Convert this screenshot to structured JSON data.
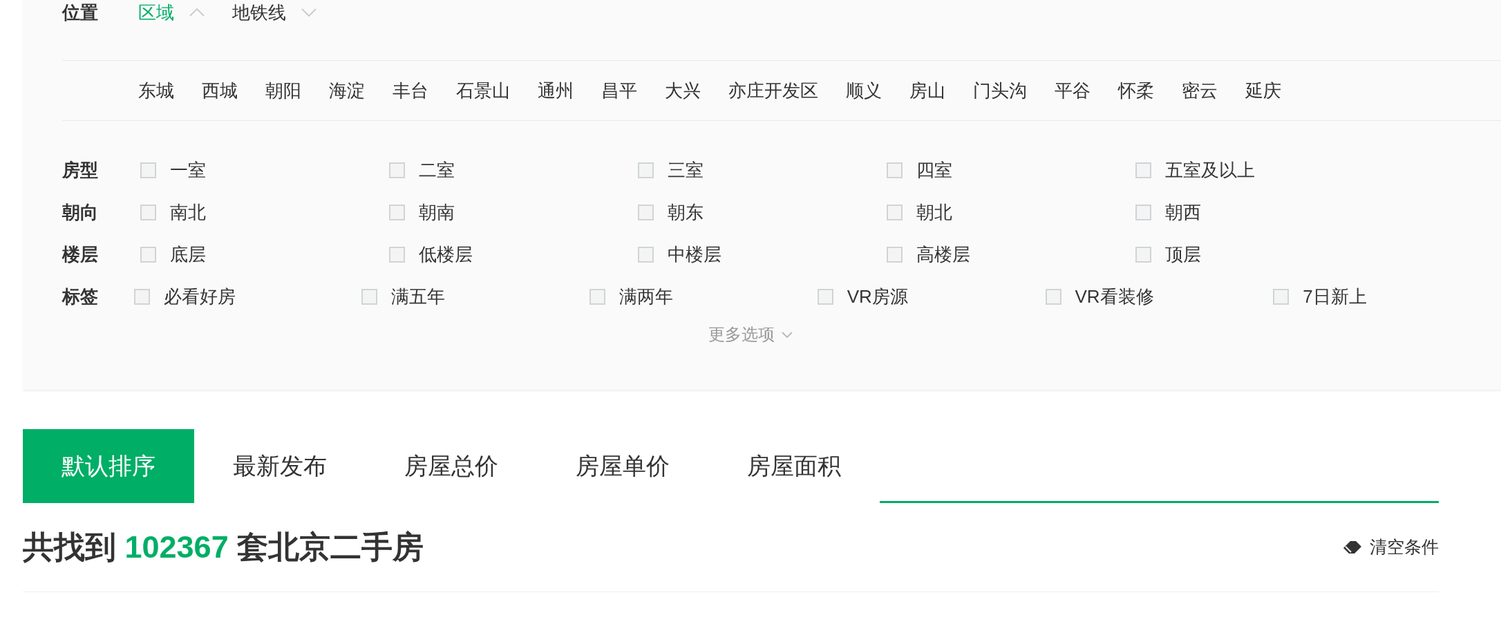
{
  "location": {
    "label": "位置",
    "tabs": [
      {
        "label": "区域",
        "selected": true,
        "expanded": true
      },
      {
        "label": "地铁线",
        "selected": false,
        "expanded": false
      }
    ],
    "districts": [
      "东城",
      "西城",
      "朝阳",
      "海淀",
      "丰台",
      "石景山",
      "通州",
      "昌平",
      "大兴",
      "亦庄开发区",
      "顺义",
      "房山",
      "门头沟",
      "平谷",
      "怀柔",
      "密云",
      "延庆"
    ]
  },
  "filters": [
    {
      "label": "房型",
      "options": [
        {
          "label": "一室",
          "checked": false
        },
        {
          "label": "二室",
          "checked": false
        },
        {
          "label": "三室",
          "checked": false
        },
        {
          "label": "四室",
          "checked": false
        },
        {
          "label": "五室及以上",
          "checked": false
        }
      ]
    },
    {
      "label": "朝向",
      "options": [
        {
          "label": "南北",
          "checked": false
        },
        {
          "label": "朝南",
          "checked": false
        },
        {
          "label": "朝东",
          "checked": false
        },
        {
          "label": "朝北",
          "checked": false
        },
        {
          "label": "朝西",
          "checked": false
        }
      ]
    },
    {
      "label": "楼层",
      "options": [
        {
          "label": "底层",
          "checked": false
        },
        {
          "label": "低楼层",
          "checked": false
        },
        {
          "label": "中楼层",
          "checked": false
        },
        {
          "label": "高楼层",
          "checked": false
        },
        {
          "label": "顶层",
          "checked": false
        }
      ]
    },
    {
      "label": "标签",
      "options": [
        {
          "label": "必看好房",
          "checked": false
        },
        {
          "label": "满五年",
          "checked": false
        },
        {
          "label": "满两年",
          "checked": false
        },
        {
          "label": "VR房源",
          "checked": false
        },
        {
          "label": "VR看装修",
          "checked": false
        },
        {
          "label": "7日新上",
          "checked": false
        }
      ]
    }
  ],
  "more_options": "更多选项",
  "sort_tabs": [
    {
      "label": "默认排序",
      "selected": true
    },
    {
      "label": "最新发布",
      "selected": false
    },
    {
      "label": "房屋总价",
      "selected": false
    },
    {
      "label": "房屋单价",
      "selected": false
    },
    {
      "label": "房屋面积",
      "selected": false
    }
  ],
  "result": {
    "prefix": "共找到",
    "count": "102367",
    "suffix": "套北京二手房"
  },
  "clear_button": "清空条件"
}
